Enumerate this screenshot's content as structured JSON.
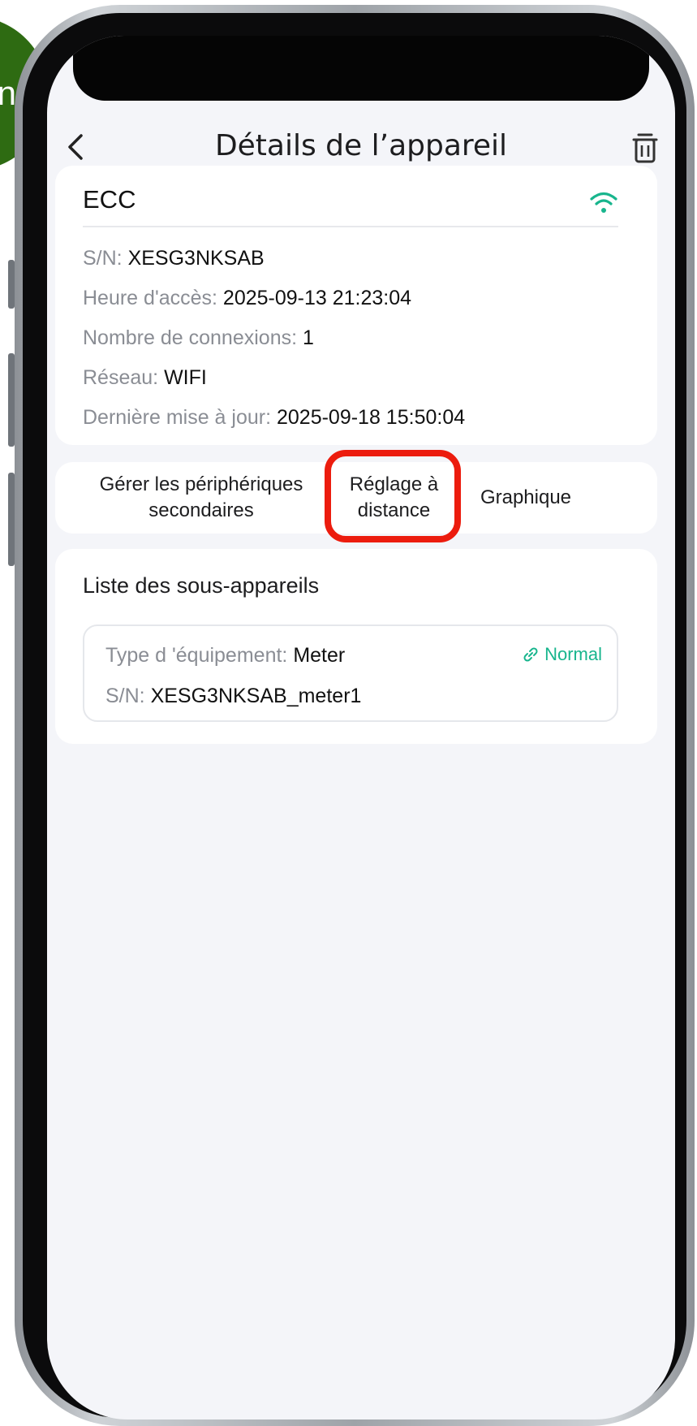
{
  "step_badge": {
    "text": "n"
  },
  "header": {
    "title": "Détails de l’appareil"
  },
  "device": {
    "name": "ECC",
    "rows": [
      {
        "label": "S/N: ",
        "value": "XESG3NKSAB"
      },
      {
        "label": "Heure d'accès: ",
        "value": "2025-09-13 21:23:04"
      },
      {
        "label": "Nombre de connexions: ",
        "value": "1"
      },
      {
        "label": "Réseau: ",
        "value": "WIFI"
      },
      {
        "label": "Dernière mise à jour: ",
        "value": "2025-09-18 15:50:04"
      }
    ]
  },
  "tabs": {
    "tab1_line1": "Gérer les périphériques",
    "tab1_line2": "secondaires",
    "tab2_line1": "Réglage à",
    "tab2_line2": "distance",
    "tab3": "Graphique"
  },
  "sub_devices": {
    "title": "Liste des sous-appareils",
    "items": [
      {
        "type_label": "Type d 'équipement: ",
        "type_value": "Meter",
        "sn_label": "S/N: ",
        "sn_value": "XESG3NKSAB_meter1",
        "status": "Normal"
      }
    ]
  },
  "colors": {
    "accent": "#18b58d",
    "highlight": "#ec1c0e",
    "badge": "#2e6b12"
  }
}
